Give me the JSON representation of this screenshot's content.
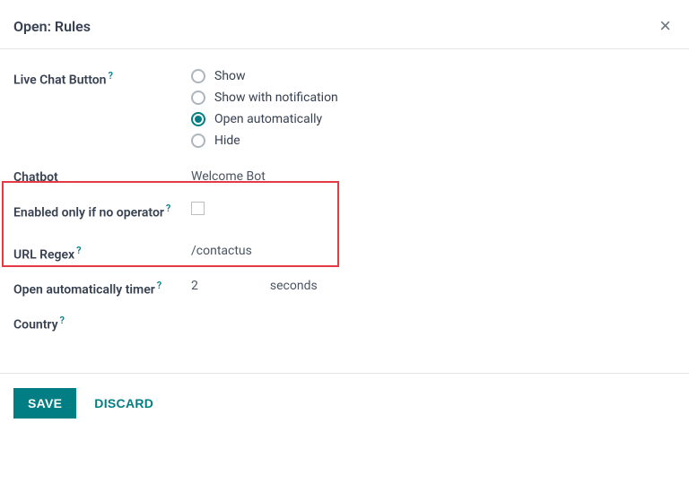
{
  "header": {
    "title": "Open: Rules",
    "close": "×"
  },
  "fields": {
    "liveChatButton": {
      "label": "Live Chat Button",
      "options": {
        "show": "Show",
        "showNotification": "Show with notification",
        "openAuto": "Open automatically",
        "hide": "Hide"
      }
    },
    "chatbot": {
      "label": "Chatbot",
      "value": "Welcome Bot"
    },
    "enabledOnlyIfNoOperator": {
      "label": "Enabled only if no operator"
    },
    "urlRegex": {
      "label": "URL Regex",
      "value": "/contactus"
    },
    "openAutoTimer": {
      "label": "Open automatically timer",
      "value": "2",
      "unit": "seconds"
    },
    "country": {
      "label": "Country"
    }
  },
  "footer": {
    "save": "SAVE",
    "discard": "DISCARD"
  },
  "help": "?"
}
